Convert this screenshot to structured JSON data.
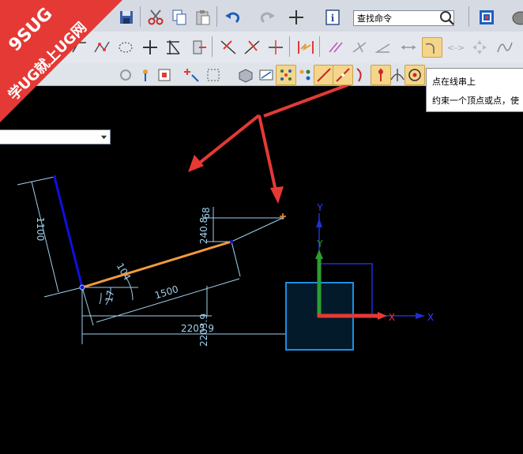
{
  "watermark": {
    "line1": "9SUG",
    "line2": "学UG就上UG网",
    "colors": {
      "red": "#e53935",
      "white": "#ffffff"
    }
  },
  "toolbar_top": {
    "search_text": "查找命令",
    "icons": [
      "save-icon",
      "cut-icon",
      "copy-icon",
      "paste-icon",
      "undo-icon",
      "redo-icon",
      "cross-icon",
      "info-icon",
      "search-icon",
      "fit-view-icon",
      "shaded-view-icon"
    ]
  },
  "toolbar_sketch": {
    "icons": [
      "profile-icon",
      "studio-spline-icon",
      "offset-curve-icon",
      "point-icon",
      "trim-icon",
      "corner-icon",
      "fillet-icon",
      "chamfer-icon",
      "extend-icon",
      "make-corner-icon",
      "quick-extend-icon",
      "auto-dimension-icon",
      "parallel-constraint-icon",
      "perpendicular-constraint-icon",
      "angle-constraint-icon",
      "horizontal-constraint-icon",
      "point-on-string-icon",
      "symmetric-icon",
      "equal-icon",
      "tangent-icon"
    ],
    "active": "point-on-string-icon"
  },
  "toolbar_filter": {
    "icons": [
      "filter-icon",
      "snap-point-icon",
      "rect-select-icon",
      "solid-view-icon",
      "show-constraints-icon",
      "constraint-display-icon",
      "line-icon",
      "arc-icon",
      "point-on-curve-icon",
      "center-point-icon"
    ]
  },
  "tooltip": {
    "title": "点在线串上",
    "description": "约束一个顶点或点，使"
  },
  "sketch": {
    "dimensions": [
      "1100",
      "1500",
      "104",
      "17",
      "2203.9",
      "2203.9",
      "68",
      "240.8"
    ],
    "axis_labels": {
      "x": "X",
      "y": "Y"
    },
    "colors": {
      "background": "#000000",
      "dimension": "#9fd0ee",
      "blue_line": "#1010e0",
      "orange_line": "#f29a3e",
      "arrow": "#e53935",
      "datum": "#1a8fe6"
    }
  }
}
